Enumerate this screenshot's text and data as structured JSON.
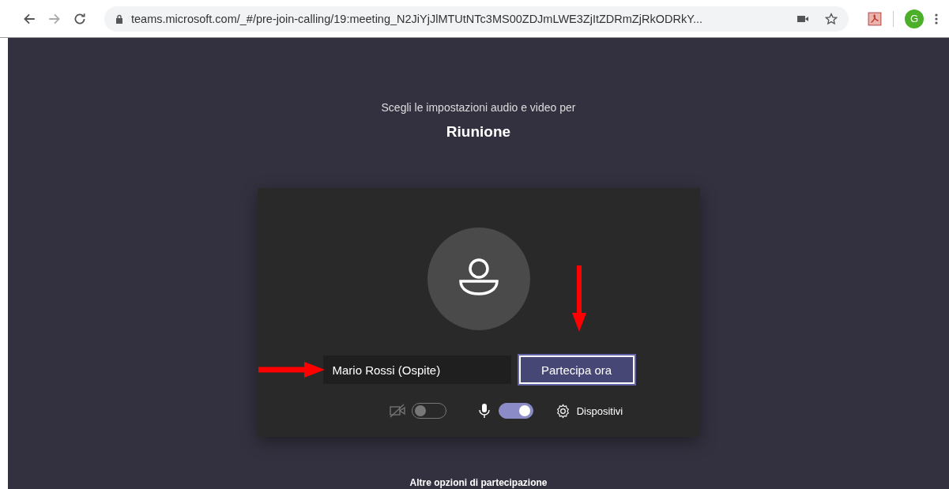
{
  "browser": {
    "url": "teams.microsoft.com/_#/pre-join-calling/19:meeting_N2JiYjJlMTUtNTc3MS00ZDJmLWE3ZjItZDRmZjRkODRkY...",
    "profile_initial": "G"
  },
  "heading": {
    "subtitle": "Scegli le impostazioni audio e video per",
    "title": "Riunione"
  },
  "name_field": {
    "value": "Mario Rossi (Ospite)"
  },
  "join_button": {
    "label": "Partecipa ora"
  },
  "toggles": [
    {
      "kind": "camera",
      "on": false
    },
    {
      "kind": "mic",
      "on": true
    }
  ],
  "devices": {
    "label": "Dispositivi"
  },
  "more_options": "Altre opzioni di partecipazione"
}
